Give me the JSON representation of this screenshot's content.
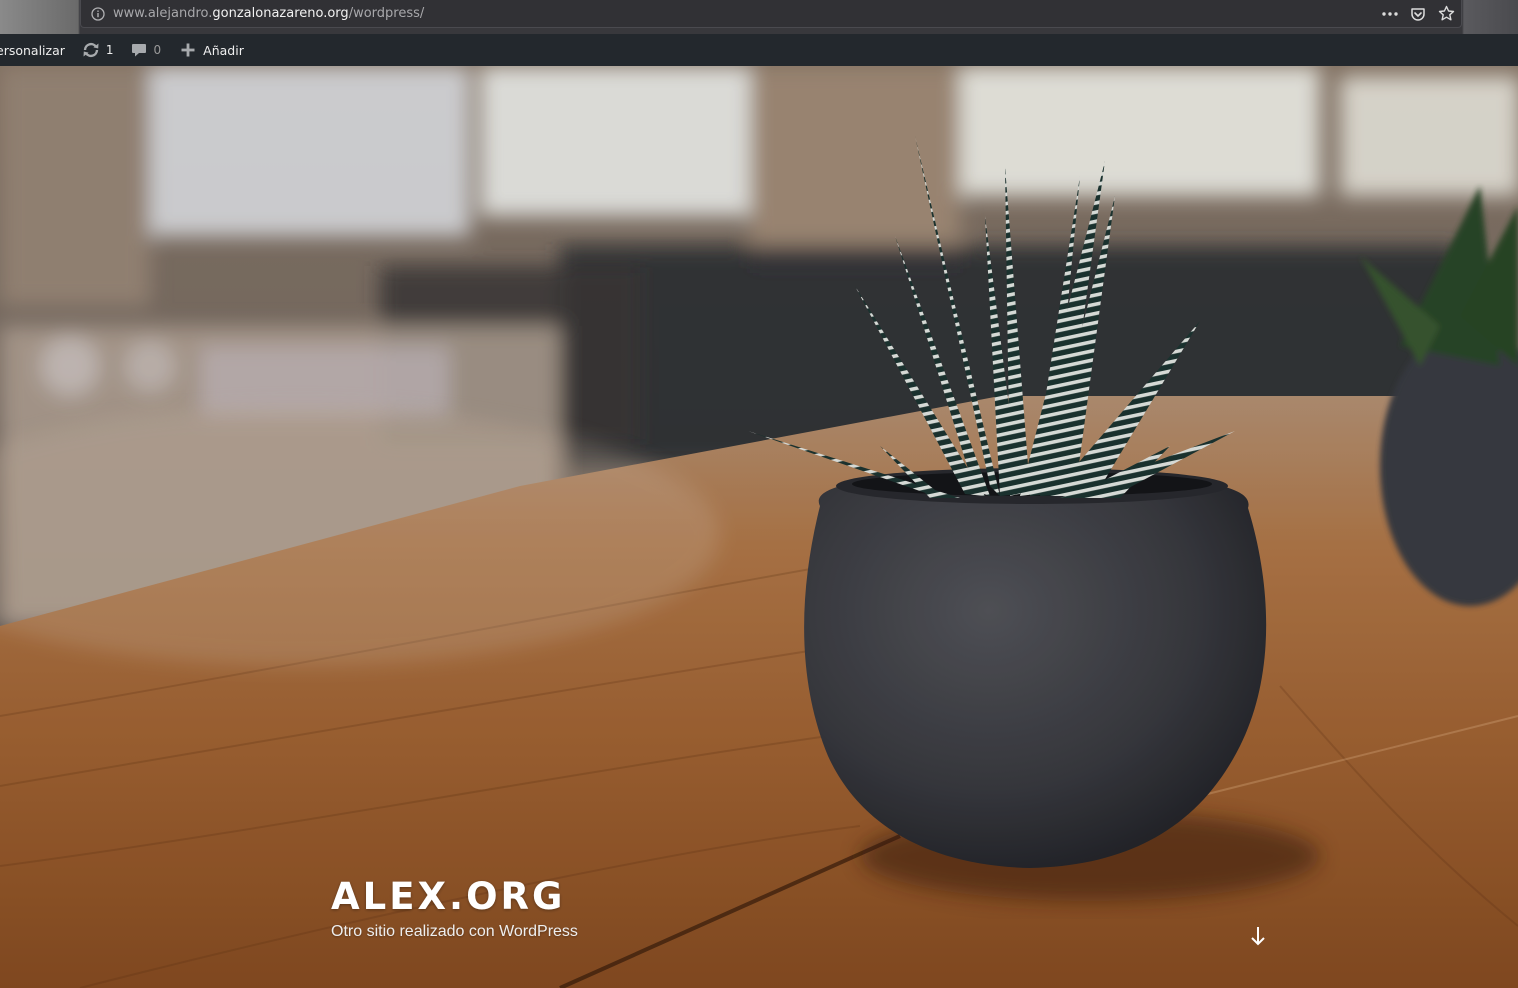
{
  "browser": {
    "url_prefix": "www.alejandro.",
    "url_domain": "gonzalonazareno.org",
    "url_path": "/wordpress/",
    "icons": [
      "info-icon",
      "more-icon",
      "pocket-icon",
      "bookmark-star-icon"
    ]
  },
  "adminbar": {
    "customize_label": "ersonalizar",
    "updates_count": "1",
    "comments_count": "0",
    "new_label": "Añadir",
    "icons": [
      "updates-icon",
      "comments-icon",
      "plus-icon"
    ]
  },
  "hero": {
    "site_title": "ALEX.ORG",
    "site_description": "Otro sitio realizado con WordPress",
    "icons": [
      "arrow-down-icon"
    ],
    "colors": {
      "adminbar_bg": "#23282d",
      "title": "#ffffff",
      "table_wood": "#b27644",
      "pot": "#3a3b40"
    }
  }
}
